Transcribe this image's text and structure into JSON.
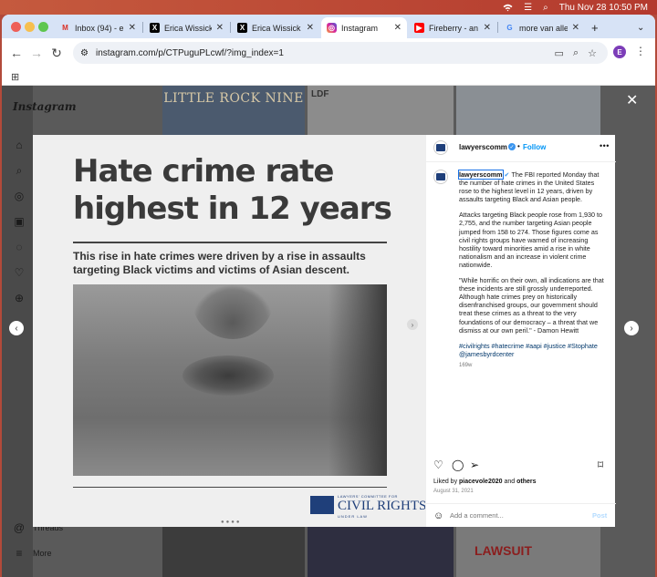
{
  "menubar": {
    "date_time": "Thu Nov 28  10:50 PM"
  },
  "tabs": [
    {
      "label": "Inbox (94) - e",
      "icon": "gmail-icon"
    },
    {
      "label": "Erica Wissick",
      "icon": "x-icon"
    },
    {
      "label": "Erica Wissick",
      "icon": "x-icon"
    },
    {
      "label": "Instagram",
      "icon": "instagram-icon"
    },
    {
      "label": "Fireberry - an",
      "icon": "youtube-icon"
    },
    {
      "label": "more van aller",
      "icon": "google-icon"
    }
  ],
  "address": {
    "url": "instagram.com/p/CTPuguPLcwf/?img_index=1",
    "profile_initial": "E"
  },
  "sidebar": {
    "logo": "Instagram",
    "threads": "Threads",
    "more": "More"
  },
  "background_posts": {
    "top_left": "LITTLE ROCK NINE",
    "top_middle": "LDF",
    "bottom_right": "LAWSUIT"
  },
  "post_image": {
    "headline": "Hate crime rate highest in 12 years",
    "subhead": "This rise in hate crimes were driven by a rise in assaults targeting Black victims and victims of Asian descent.",
    "logo_top": "LAWYERS' COMMITTEE FOR",
    "logo_main": "CIVIL RIGHTS",
    "logo_bottom": "UNDER LAW"
  },
  "post": {
    "username": "lawyerscomm",
    "follow": "Follow",
    "caption_lead": "The FBI reported Monday that the number of hate crimes in the United States rose to the highest level in 12 years, driven by assaults targeting Black and Asian people.",
    "caption_p2": "Attacks targeting Black people rose from 1,930 to 2,755, and the number targeting Asian people jumped from 158 to 274. Those figures come as civil rights groups have warned of increasing hostility toward minorities amid a rise in white nationalism and an increase in violent crime nationwide.",
    "caption_p3": "\"While horrific on their own, all indications are that these incidents are still grossly underreported. Although hate crimes prey on historically disenfranchised groups, our government should treat these crimes as a threat to the very foundations of our democracy – a threat that we dismiss at our own peril.\" - Damon Hewitt",
    "hashtags": "#civilrights #hatecrime #aapi #justice #Stophate @jamesbyrdcenter",
    "age": "169w",
    "liked_by_prefix": "Liked by ",
    "liked_by_user": "piacevole2020",
    "liked_by_suffix": " and ",
    "liked_by_others": "others",
    "date": "August 31, 2021",
    "comment_placeholder": "Add a comment...",
    "post_button": "Post"
  }
}
